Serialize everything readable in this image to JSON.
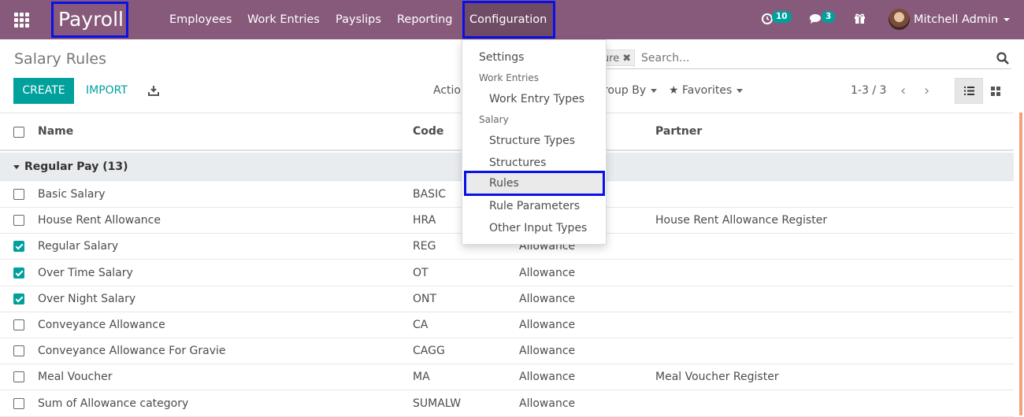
{
  "navbar": {
    "brand": "Payroll",
    "menu": [
      "Employees",
      "Work Entries",
      "Payslips",
      "Reporting"
    ],
    "active_menu": "Configuration",
    "activity_badge": "10",
    "messages_badge": "3",
    "user_name": "Mitchell Admin"
  },
  "control_panel": {
    "title": "Salary Rules",
    "facet_text": "ure",
    "search_placeholder": "Search...",
    "create_label": "CREATE",
    "import_label": "IMPORT",
    "action_label": "Actio",
    "groupby_label": "roup By",
    "favorites_label": "Favorites",
    "pager": "1-3 / 3"
  },
  "table": {
    "headers": {
      "name": "Name",
      "code": "Code",
      "partner": "Partner"
    },
    "group": "Regular Pay (13)",
    "rows": [
      {
        "name": "Basic Salary",
        "code": "BASIC",
        "category": "",
        "partner": "",
        "checked": false
      },
      {
        "name": "House Rent Allowance",
        "code": "HRA",
        "category": "",
        "partner": "House Rent Allowance Register",
        "checked": false
      },
      {
        "name": "Regular Salary",
        "code": "REG",
        "category": "Allowance",
        "partner": "",
        "checked": true
      },
      {
        "name": "Over Time Salary",
        "code": "OT",
        "category": "Allowance",
        "partner": "",
        "checked": true
      },
      {
        "name": "Over Night Salary",
        "code": "ONT",
        "category": "Allowance",
        "partner": "",
        "checked": true
      },
      {
        "name": "Conveyance Allowance",
        "code": "CA",
        "category": "Allowance",
        "partner": "",
        "checked": false
      },
      {
        "name": "Conveyance Allowance For Gravie",
        "code": "CAGG",
        "category": "Allowance",
        "partner": "",
        "checked": false
      },
      {
        "name": "Meal Voucher",
        "code": "MA",
        "category": "Allowance",
        "partner": "Meal Voucher Register",
        "checked": false
      },
      {
        "name": "Sum of Allowance category",
        "code": "SUMALW",
        "category": "Allowance",
        "partner": "",
        "checked": false
      }
    ]
  },
  "dropdown": {
    "settings": "Settings",
    "work_entries_header": "Work Entries",
    "work_entry_types": "Work Entry Types",
    "salary_header": "Salary",
    "structure_types": "Structure Types",
    "structures": "Structures",
    "rules": "Rules",
    "rule_parameters": "Rule Parameters",
    "other_input_types": "Other Input Types"
  },
  "colors": {
    "navbar": "#875a7b",
    "accent": "#00a09d",
    "highlight_border": "#0a10e8"
  }
}
